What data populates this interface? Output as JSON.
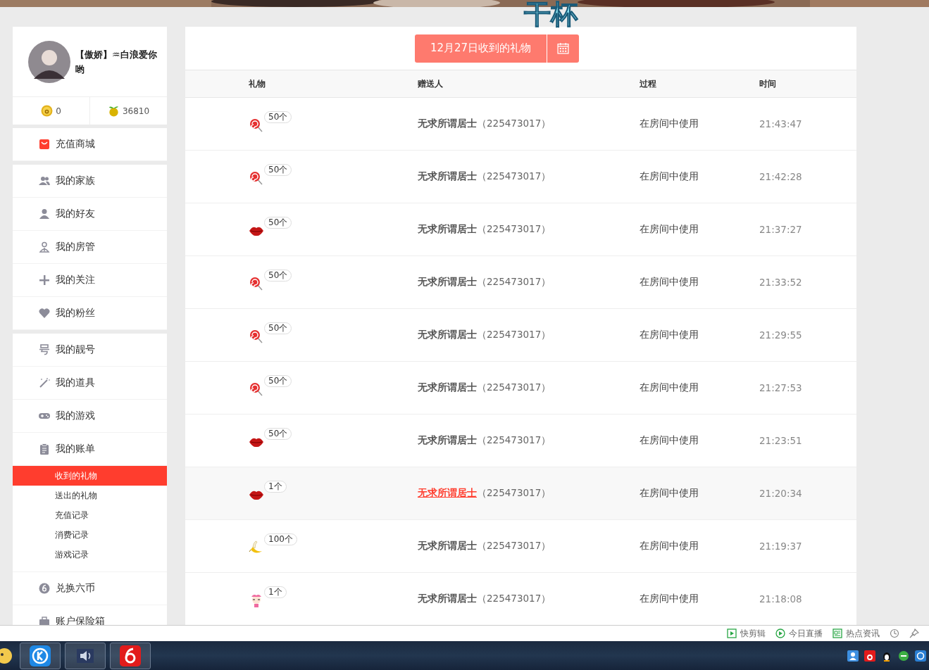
{
  "banner": {
    "overlay_text": "干杯"
  },
  "profile": {
    "name": "【傲娇】♒白浪爱你哟",
    "coins": "0",
    "beans": "36810"
  },
  "menu_groups": [
    [
      {
        "label": "充值商城",
        "kind": "bag"
      }
    ],
    [
      {
        "label": "我的家族",
        "kind": "people"
      },
      {
        "label": "我的好友",
        "kind": "person"
      },
      {
        "label": "我的房管",
        "kind": "manager"
      },
      {
        "label": "我的关注",
        "kind": "plus"
      },
      {
        "label": "我的粉丝",
        "kind": "heart"
      }
    ],
    [
      {
        "label": "我的靓号",
        "kind": "number"
      },
      {
        "label": "我的道具",
        "kind": "wand"
      },
      {
        "label": "我的游戏",
        "kind": "gamepad"
      },
      {
        "label": "我的账单",
        "kind": "clipboard",
        "children": [
          {
            "label": "收到的礼物",
            "selected": true
          },
          {
            "label": "送出的礼物",
            "selected": false
          },
          {
            "label": "充值记录",
            "selected": false
          },
          {
            "label": "消费记录",
            "selected": false
          },
          {
            "label": "游戏记录",
            "selected": false
          }
        ]
      },
      {
        "label": "兑换六币",
        "kind": "six"
      },
      {
        "label": "账户保险箱",
        "kind": "case"
      }
    ]
  ],
  "date_button": {
    "label": "12月27日收到的礼物"
  },
  "table": {
    "columns": [
      "礼物",
      "赠送人",
      "过程",
      "时间"
    ],
    "rows": [
      {
        "kind": "lollipop",
        "count": "50个",
        "sender": "无求所谓居士",
        "sender_id": "（225473017）",
        "process": "在房间中使用",
        "time": "21:43:47",
        "hovered": false
      },
      {
        "kind": "lollipop",
        "count": "50个",
        "sender": "无求所谓居士",
        "sender_id": "（225473017）",
        "process": "在房间中使用",
        "time": "21:42:28",
        "hovered": false
      },
      {
        "kind": "lips",
        "count": "50个",
        "sender": "无求所谓居士",
        "sender_id": "（225473017）",
        "process": "在房间中使用",
        "time": "21:37:27",
        "hovered": false
      },
      {
        "kind": "lollipop",
        "count": "50个",
        "sender": "无求所谓居士",
        "sender_id": "（225473017）",
        "process": "在房间中使用",
        "time": "21:33:52",
        "hovered": false
      },
      {
        "kind": "lollipop",
        "count": "50个",
        "sender": "无求所谓居士",
        "sender_id": "（225473017）",
        "process": "在房间中使用",
        "time": "21:29:55",
        "hovered": false
      },
      {
        "kind": "lollipop",
        "count": "50个",
        "sender": "无求所谓居士",
        "sender_id": "（225473017）",
        "process": "在房间中使用",
        "time": "21:27:53",
        "hovered": false
      },
      {
        "kind": "lips",
        "count": "50个",
        "sender": "无求所谓居士",
        "sender_id": "（225473017）",
        "process": "在房间中使用",
        "time": "21:23:51",
        "hovered": false
      },
      {
        "kind": "lips",
        "count": "1个",
        "sender": "无求所谓居士",
        "sender_id": "（225473017）",
        "process": "在房间中使用",
        "time": "21:20:34",
        "hovered": true
      },
      {
        "kind": "banana",
        "count": "100个",
        "sender": "无求所谓居士",
        "sender_id": "（225473017）",
        "process": "在房间中使用",
        "time": "21:19:37",
        "hovered": false
      },
      {
        "kind": "doll",
        "count": "1个",
        "sender": "无求所谓居士",
        "sender_id": "（225473017）",
        "process": "在房间中使用",
        "time": "21:18:08",
        "hovered": false
      }
    ]
  },
  "status_bar": {
    "items": [
      "快剪辑",
      "今日直播",
      "热点资讯"
    ]
  }
}
